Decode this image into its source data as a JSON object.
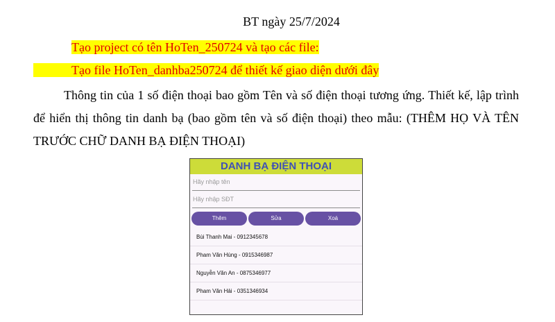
{
  "doc": {
    "title": "BT ngày 25/7/2024",
    "highlight_line_1": "Tạo project có tên HoTen_250724 và tạo các file:",
    "highlight_line_2": "Tạo file  HoTen_danhba250724 để thiết kế giao diện dưới đây",
    "paragraph": "Thông tin của 1 số điện thoại bao gồm Tên và số điện thoại tương ứng. Thiết kế, lập trình để hiển thị thông tin danh bạ (bao gồm tên và số điện thoại) theo mẫu: (THÊM HỌ VÀ TÊN TRƯỚC CHỮ DANH BẠ ĐIỆN THOẠI)"
  },
  "phone": {
    "header_title": "DANH BẠ ĐIỆN THOẠI",
    "name_placeholder": "Hãy nhập tên",
    "phone_placeholder": "Hãy nhập SĐT",
    "buttons": [
      "Thêm",
      "Sửa",
      "Xoá"
    ],
    "contacts": [
      "Bùi Thanh Mai - 0912345678",
      "Pham Văn Hùng - 0915346987",
      "Nguyễn Văn An - 0875346977",
      "Pham Văn Hải - 0351346934"
    ],
    "colors": {
      "header_bg": "#cddc39",
      "header_text": "#3f51b5",
      "button_bg": "#6751a4",
      "highlight": "#ffff00",
      "highlight_text": "#e00000"
    }
  }
}
